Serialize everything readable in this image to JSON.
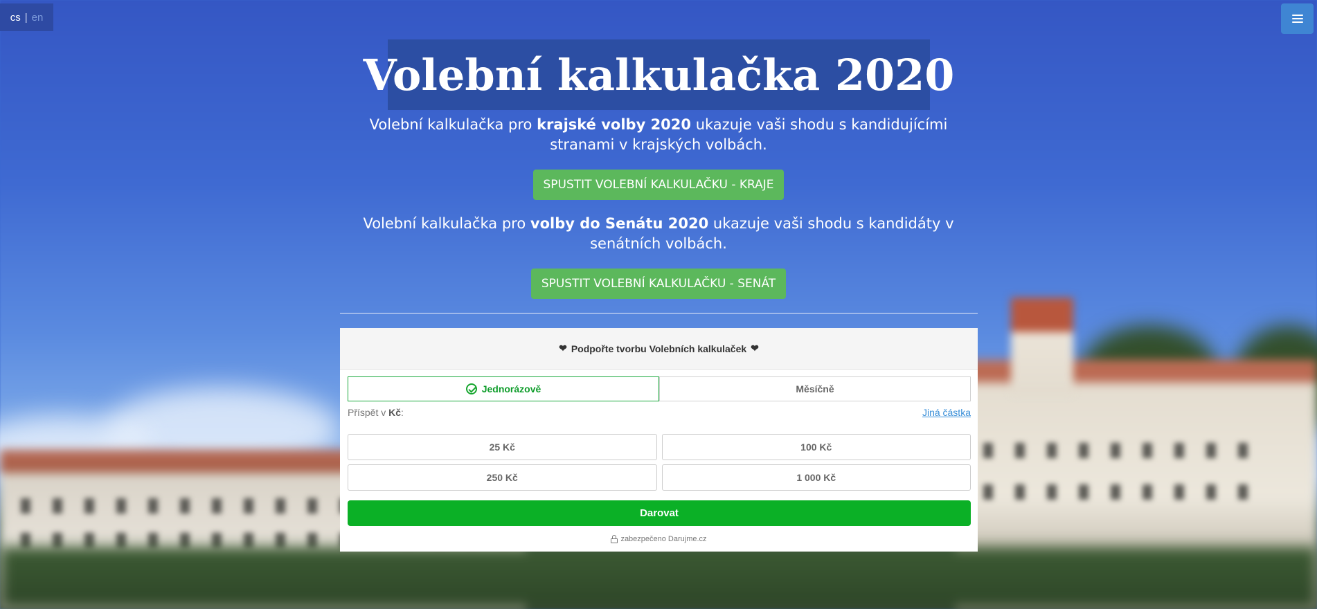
{
  "lang": {
    "active": "cs",
    "separator": "|",
    "inactive": "en"
  },
  "hero": {
    "title": "Volební kalkulačka 2020",
    "regional": {
      "pre": "Volební kalkulačka pro ",
      "bold": "krajské volby 2020",
      "post": " ukazuje vaši shodu s kandidujícími stranami v krajských volbách.",
      "button": "SPUSTIT VOLEBNÍ KALKULAČKU - KRAJE"
    },
    "senate": {
      "pre": "Volební kalkulačka pro ",
      "bold": "volby do Senátu 2020",
      "post": " ukazuje vaši shodu s kandidáty v senátních volbách.",
      "button": "SPUSTIT VOLEBNÍ KALKULAČKU - SENÁT"
    }
  },
  "donation": {
    "heading": "Podpořte tvorbu Volebních kalkulaček",
    "frequency": {
      "one_time": "Jednorázově",
      "monthly": "Měsíčně"
    },
    "amount_label_pre": "Příspět v ",
    "amount_label_currency": "Kč",
    "amount_label_post": ":",
    "other_amount": "Jiná částka",
    "amounts": [
      "25 Kč",
      "100 Kč",
      "250 Kč",
      "1 000 Kč"
    ],
    "donate_button": "Darovat",
    "secured_text": "zabezpečeno Darujme.cz"
  },
  "colors": {
    "cta_green": "#5cb85c",
    "donate_green": "#0bb026",
    "title_bg": "#2c4ea3",
    "menu_blue": "#3f85d3"
  },
  "icons": {
    "menu": "hamburger-icon",
    "heart": "heart-icon",
    "check": "check-circle-icon",
    "lock": "lock-icon"
  }
}
